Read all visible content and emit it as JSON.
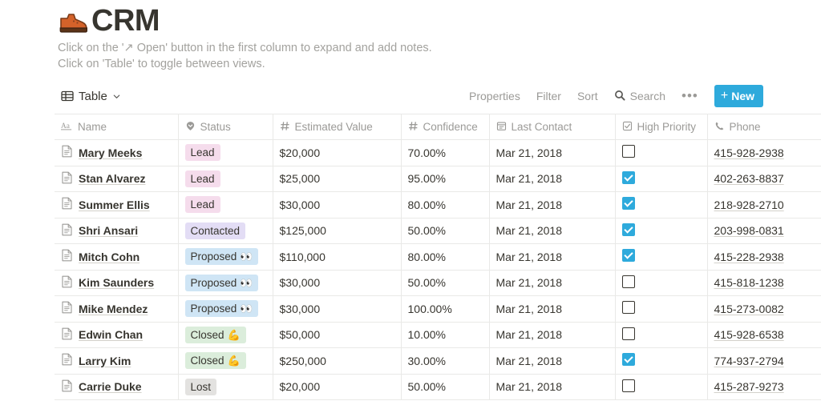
{
  "header": {
    "icon": "hiking-boot-emoji",
    "title": "CRM",
    "description_line1": "Click on the '↗ Open' button in the first column to expand and add notes.",
    "description_line2": "Click on 'Table' to toggle between views."
  },
  "toolbar": {
    "view_label": "Table",
    "view_icon": "table-grid-icon",
    "chevron_icon": "chevron-down-icon",
    "properties_label": "Properties",
    "filter_label": "Filter",
    "sort_label": "Sort",
    "search_label": "Search",
    "search_icon": "search-icon",
    "more_label": "•••",
    "new_label": "New",
    "new_plus": "+",
    "new_button_color": "#2eaadc"
  },
  "table": {
    "columns": [
      {
        "label": "Name",
        "icon": "text-aa-icon",
        "align": "left"
      },
      {
        "label": "Status",
        "icon": "select-tag-icon",
        "align": "left"
      },
      {
        "label": "Estimated Value",
        "icon": "number-hash-icon",
        "align": "right"
      },
      {
        "label": "Confidence",
        "icon": "number-hash-icon",
        "align": "right"
      },
      {
        "label": "Last Contact",
        "icon": "calendar-icon",
        "align": "left"
      },
      {
        "label": "High Priority",
        "icon": "checkbox-icon",
        "align": "left"
      },
      {
        "label": "Phone",
        "icon": "phone-icon",
        "align": "left"
      }
    ],
    "status_colors": {
      "Lead": "#f5dcec",
      "Contacted": "#e3ddf5",
      "Proposed": "#cfe5f5",
      "Closed": "#dbeddb",
      "Lost": "#e3e2e0"
    },
    "rows": [
      {
        "name": "Mary Meeks",
        "status": "Lead",
        "status_emoji": "",
        "estimated_value": "$20,000",
        "confidence": "70.00%",
        "last_contact": "Mar 21, 2018",
        "high_priority": false,
        "phone": "415-928-2938"
      },
      {
        "name": "Stan Alvarez",
        "status": "Lead",
        "status_emoji": "",
        "estimated_value": "$25,000",
        "confidence": "95.00%",
        "last_contact": "Mar 21, 2018",
        "high_priority": true,
        "phone": "402-263-8837"
      },
      {
        "name": "Summer Ellis",
        "status": "Lead",
        "status_emoji": "",
        "estimated_value": "$30,000",
        "confidence": "80.00%",
        "last_contact": "Mar 21, 2018",
        "high_priority": true,
        "phone": "218-928-2710"
      },
      {
        "name": "Shri Ansari",
        "status": "Contacted",
        "status_emoji": "",
        "estimated_value": "$125,000",
        "confidence": "50.00%",
        "last_contact": "Mar 21, 2018",
        "high_priority": true,
        "phone": "203-998-0831"
      },
      {
        "name": "Mitch Cohn",
        "status": "Proposed",
        "status_emoji": "👀",
        "estimated_value": "$110,000",
        "confidence": "80.00%",
        "last_contact": "Mar 21, 2018",
        "high_priority": true,
        "phone": "415-228-2938"
      },
      {
        "name": "Kim Saunders",
        "status": "Proposed",
        "status_emoji": "👀",
        "estimated_value": "$30,000",
        "confidence": "50.00%",
        "last_contact": "Mar 21, 2018",
        "high_priority": false,
        "phone": "415-818-1238"
      },
      {
        "name": "Mike Mendez",
        "status": "Proposed",
        "status_emoji": "👀",
        "estimated_value": "$30,000",
        "confidence": "100.00%",
        "last_contact": "Mar 21, 2018",
        "high_priority": false,
        "phone": "415-273-0082"
      },
      {
        "name": "Edwin Chan",
        "status": "Closed",
        "status_emoji": "💪",
        "estimated_value": "$50,000",
        "confidence": "10.00%",
        "last_contact": "Mar 21, 2018",
        "high_priority": false,
        "phone": "415-928-6538"
      },
      {
        "name": "Larry Kim",
        "status": "Closed",
        "status_emoji": "💪",
        "estimated_value": "$250,000",
        "confidence": "30.00%",
        "last_contact": "Mar 21, 2018",
        "high_priority": true,
        "phone": "774-937-2794"
      },
      {
        "name": "Carrie Duke",
        "status": "Lost",
        "status_emoji": "",
        "estimated_value": "$20,000",
        "confidence": "50.00%",
        "last_contact": "Mar 21, 2018",
        "high_priority": false,
        "phone": "415-287-9273"
      }
    ]
  }
}
